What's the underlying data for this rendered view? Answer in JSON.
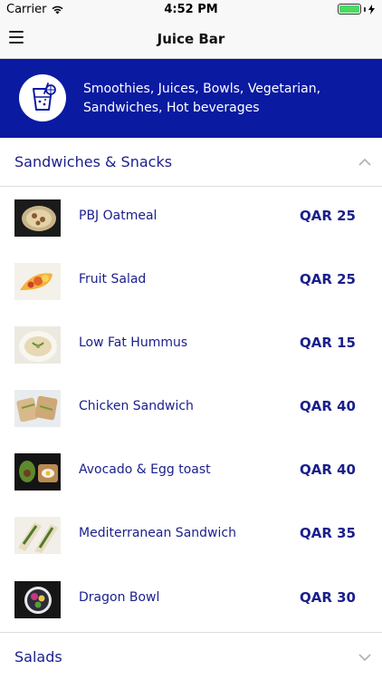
{
  "status_bar": {
    "carrier": "Carrier",
    "time": "4:52 PM",
    "icons": [
      "wifi-icon",
      "battery-icon",
      "charging-icon"
    ]
  },
  "nav": {
    "title": "Juice Bar",
    "menu_icon": "hamburger-menu-icon"
  },
  "banner": {
    "icon": "drink-glass-icon",
    "text": "Smoothies, Juices, Bowls, Vegetarian, Sandwiches, Hot beverages"
  },
  "sections": [
    {
      "title": "Sandwiches & Snacks",
      "expanded": true,
      "items": [
        {
          "name": "PBJ Oatmeal",
          "price": "QAR 25"
        },
        {
          "name": "Fruit Salad",
          "price": "QAR 25"
        },
        {
          "name": "Low Fat Hummus",
          "price": "QAR 15"
        },
        {
          "name": "Chicken Sandwich",
          "price": "QAR 40"
        },
        {
          "name": "Avocado & Egg toast",
          "price": "QAR 40"
        },
        {
          "name": "Mediterranean Sandwich",
          "price": "QAR 35"
        },
        {
          "name": "Dragon Bowl",
          "price": "QAR 30"
        }
      ]
    },
    {
      "title": "Salads",
      "expanded": false
    }
  ],
  "colors": {
    "brand_blue": "#0a1aa1",
    "text_blue": "#1a1f8c",
    "nav_bg": "#f8f8f8",
    "battery_green": "#4cd964"
  }
}
